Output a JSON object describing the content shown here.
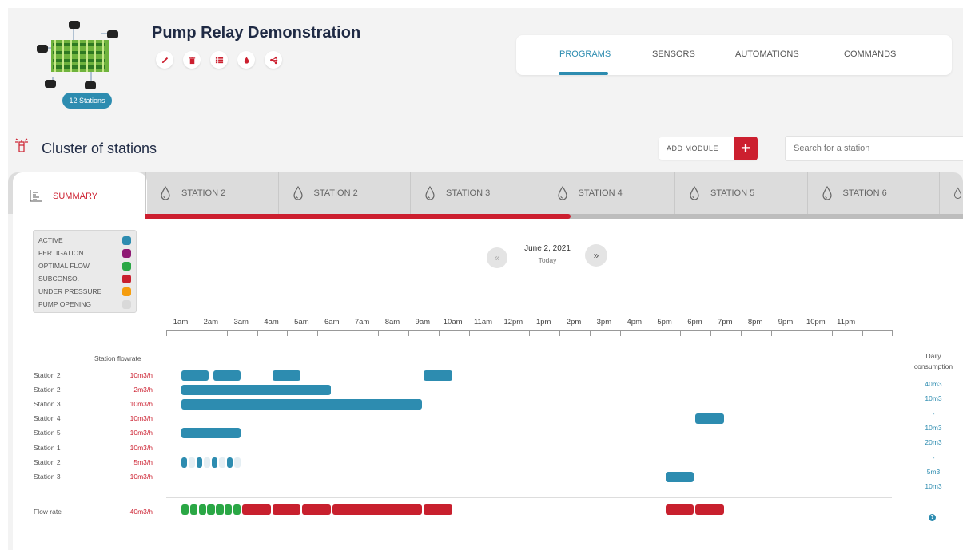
{
  "header": {
    "title": "Pump Relay Demonstration",
    "stations_badge": "12 Stations",
    "action_icons": [
      "pencil-icon",
      "trash-icon",
      "list-icon",
      "drop-icon",
      "share-icon"
    ]
  },
  "nav": {
    "tabs": [
      "PROGRAMS",
      "SENSORS",
      "AUTOMATIONS",
      "COMMANDS"
    ],
    "active": "PROGRAMS"
  },
  "cluster": {
    "title": "Cluster of stations",
    "add_module_label": "ADD MODULE",
    "add_icon": "+",
    "search_placeholder": "Search for a station"
  },
  "tabs": {
    "summary_label": "SUMMARY",
    "stations": [
      "STATION 2",
      "STATION 2",
      "STATION 3",
      "STATION 4",
      "STATION 5",
      "STATION 6"
    ]
  },
  "legend": [
    {
      "label": "ACTIVE",
      "color": "#2d8cb0"
    },
    {
      "label": "FERTIGATION",
      "color": "#8e1a74"
    },
    {
      "label": "OPTIMAL FLOW",
      "color": "#2aa745"
    },
    {
      "label": "SUBCONSO.",
      "color": "#c8202e"
    },
    {
      "label": "UNDER PRESSURE",
      "color": "#f59d0e"
    },
    {
      "label": "PUMP OPENING",
      "color": "#d9d9d9"
    }
  ],
  "date": {
    "prev": "«",
    "next": "»",
    "label": "June 2, 2021",
    "sub": "Today"
  },
  "timeline": {
    "hours": [
      "1am",
      "2am",
      "3am",
      "4am",
      "5am",
      "6am",
      "7am",
      "8am",
      "9am",
      "10am",
      "11am",
      "12pm",
      "1pm",
      "2pm",
      "3pm",
      "4pm",
      "5pm",
      "6pm",
      "7pm",
      "8pm",
      "9pm",
      "10pm",
      "11pm"
    ],
    "flowrate_header": "Station flowrate",
    "consumption_header_1": "Daily",
    "consumption_header_2": "consumption"
  },
  "rows": [
    {
      "name": "Station 2",
      "flow": "10m3/h",
      "consumption": "40m3",
      "bars": [
        {
          "start": 1.0,
          "end": 1.95,
          "status": "active"
        },
        {
          "start": 2.05,
          "end": 3.0,
          "status": "active"
        },
        {
          "start": 4.0,
          "end": 5.0,
          "status": "active"
        },
        {
          "start": 9.0,
          "end": 10.0,
          "status": "active"
        }
      ]
    },
    {
      "name": "Station 2",
      "flow": "2m3/h",
      "consumption": "10m3",
      "bars": [
        {
          "start": 1.0,
          "end": 6.0,
          "status": "active"
        }
      ]
    },
    {
      "name": "Station 3",
      "flow": "10m3/h",
      "consumption": "-",
      "bars": [
        {
          "start": 1.0,
          "end": 9.0,
          "status": "active"
        }
      ]
    },
    {
      "name": "Station 4",
      "flow": "10m3/h",
      "consumption": "10m3",
      "bars": [
        {
          "start": 18.0,
          "end": 19.0,
          "status": "active"
        }
      ]
    },
    {
      "name": "Station 5",
      "flow": "10m3/h",
      "consumption": "20m3",
      "bars": [
        {
          "start": 1.0,
          "end": 3.0,
          "status": "active"
        }
      ]
    },
    {
      "name": "Station 1",
      "flow": "10m3/h",
      "consumption": "-",
      "bars": []
    },
    {
      "name": "Station 2",
      "flow": "5m3/h",
      "consumption": "5m3",
      "bars": [
        {
          "start": 1.0,
          "end": 1.25,
          "status": "active"
        },
        {
          "start": 1.25,
          "end": 1.5,
          "status": "pump_opening"
        },
        {
          "start": 1.5,
          "end": 1.75,
          "status": "active"
        },
        {
          "start": 1.75,
          "end": 2.0,
          "status": "pump_opening"
        },
        {
          "start": 2.0,
          "end": 2.25,
          "status": "active"
        },
        {
          "start": 2.25,
          "end": 2.5,
          "status": "pump_opening"
        },
        {
          "start": 2.5,
          "end": 2.75,
          "status": "active"
        },
        {
          "start": 2.75,
          "end": 3.0,
          "status": "pump_opening"
        }
      ]
    },
    {
      "name": "Station 3",
      "flow": "10m3/h",
      "consumption": "10m3",
      "bars": [
        {
          "start": 17.0,
          "end": 18.0,
          "status": "active"
        }
      ]
    }
  ],
  "flow_row": {
    "name": "Flow rate",
    "flow": "40m3/h",
    "help_icon": "?",
    "bars": [
      {
        "start": 1.0,
        "end": 3.0,
        "status": "optimal_flow",
        "segments": 7
      },
      {
        "start": 3.0,
        "end": 4.0,
        "status": "subconso"
      },
      {
        "start": 4.0,
        "end": 5.0,
        "status": "subconso"
      },
      {
        "start": 5.0,
        "end": 6.0,
        "status": "subconso"
      },
      {
        "start": 6.0,
        "end": 9.0,
        "status": "subconso"
      },
      {
        "start": 9.0,
        "end": 10.0,
        "status": "subconso"
      },
      {
        "start": 17.0,
        "end": 18.0,
        "status": "subconso"
      },
      {
        "start": 18.0,
        "end": 19.0,
        "status": "subconso"
      }
    ]
  },
  "status_colors": {
    "active": "#2d8cb0",
    "pump_opening": "#e4eef3",
    "optimal_flow": "#2aa745",
    "subconso": "#c8202e"
  }
}
